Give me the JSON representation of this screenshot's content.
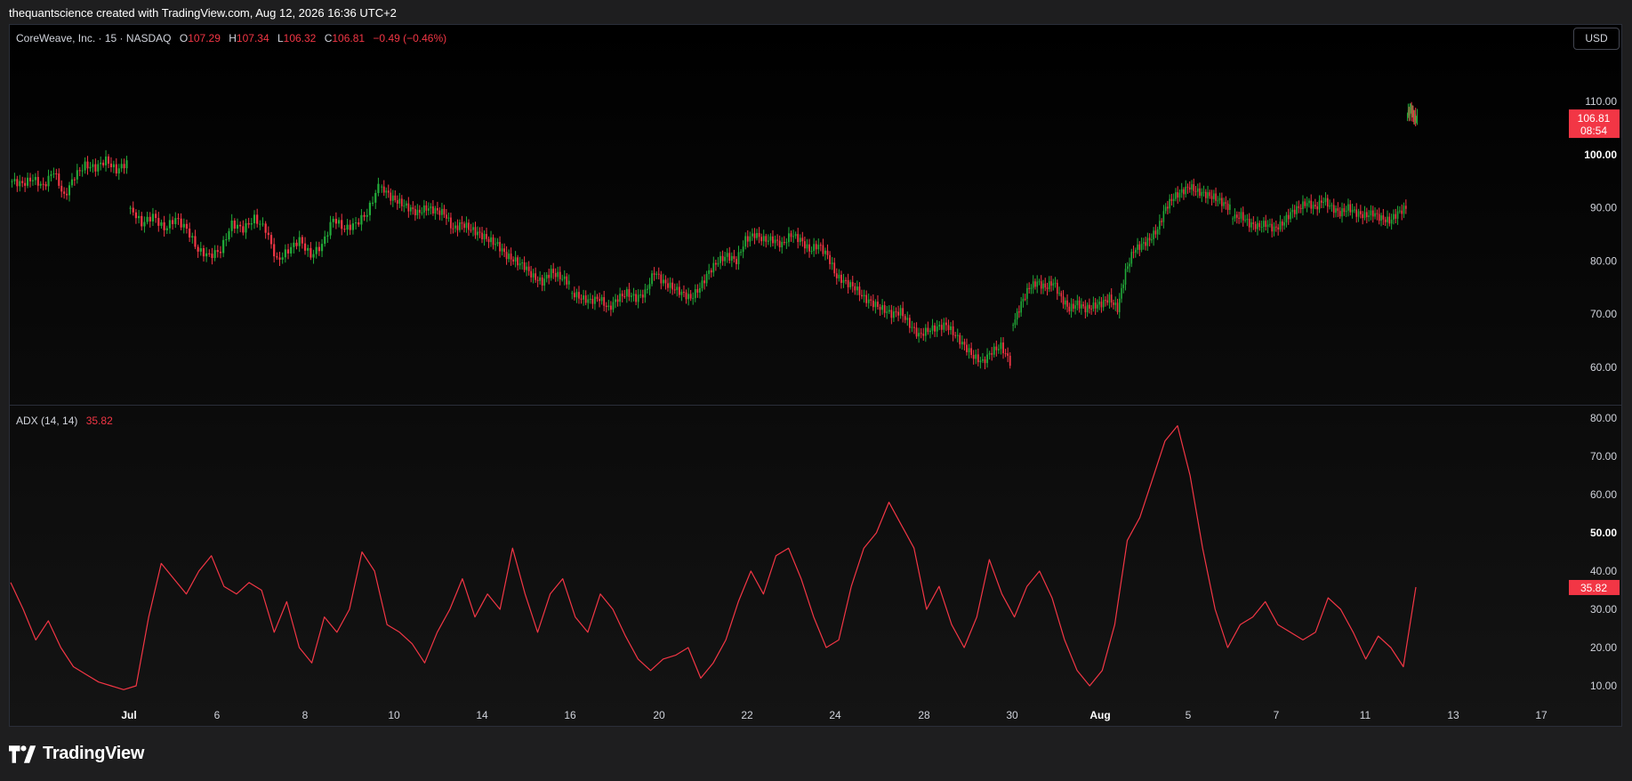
{
  "header": {
    "credit": "thequantscience created with TradingView.com, Aug 12, 2026 16:36 UTC+2"
  },
  "legend": {
    "symbol": "CoreWeave, Inc. · 15 · NASDAQ",
    "o_label": "O",
    "o": "107.29",
    "h_label": "H",
    "h": "107.34",
    "l_label": "L",
    "l": "106.32",
    "c_label": "C",
    "c": "106.81",
    "change": "−0.49 (−0.46%)"
  },
  "indicator_legend": {
    "name": "ADX (14, 14)",
    "value": "35.82"
  },
  "currency_button": "USD",
  "brand": {
    "name": "TradingView"
  },
  "colors": {
    "up": "#22ab3a",
    "down": "#f23645",
    "adx": "#f23645",
    "background": "#000000",
    "page": "#1e1e1f"
  },
  "chart_data": [
    {
      "type": "candlestick",
      "title": "CoreWeave, Inc. · 15 · NASDAQ",
      "ylim": [
        55,
        120
      ],
      "y_ticks": [
        60,
        70,
        80,
        90,
        100,
        110
      ],
      "y_tick_labels": [
        "60.00",
        "70.00",
        "80.00",
        "90.00",
        "100.00",
        "110.00"
      ],
      "x_ticks": [
        "Jul",
        "6",
        "8",
        "10",
        "14",
        "16",
        "20",
        "22",
        "24",
        "28",
        "30",
        "Aug",
        "5",
        "7",
        "11",
        "13",
        "17"
      ],
      "price_label": "106.81",
      "countdown": "08:54",
      "series": [
        {
          "session": 1,
          "prices": [
            95,
            94.5,
            95.5,
            94,
            97,
            92,
            96,
            98,
            97.5,
            99,
            97,
            98.5
          ]
        },
        {
          "session": 2,
          "prices": [
            90,
            87,
            88.5,
            86,
            88,
            86,
            82,
            81,
            82,
            87,
            86,
            88,
            86,
            80,
            82,
            84,
            81,
            83,
            88,
            86,
            87,
            89,
            94
          ]
        },
        {
          "session": 3,
          "prices": [
            94,
            92,
            91,
            90,
            89,
            90,
            89.5,
            89,
            86,
            87,
            86,
            85,
            84,
            83,
            81,
            80,
            79,
            77,
            76,
            78,
            77,
            76
          ]
        },
        {
          "session": 4,
          "prices": [
            74,
            73,
            72.5,
            73,
            71,
            73,
            74,
            73,
            74,
            78,
            76,
            75,
            74,
            73,
            75,
            78,
            80,
            81,
            80,
            84,
            85,
            84,
            84,
            83,
            85,
            84,
            82,
            83,
            81,
            77,
            76,
            75,
            73,
            72,
            71,
            70,
            70.5,
            68,
            66,
            67,
            67.5,
            68,
            66,
            64,
            62,
            61,
            63,
            64,
            61
          ]
        },
        {
          "session": 5,
          "prices": [
            68,
            72,
            75,
            76,
            75,
            76,
            73,
            71,
            72,
            71,
            71.5,
            72,
            73,
            71,
            78,
            82,
            83,
            84,
            86,
            90,
            92,
            93,
            94,
            93,
            92.5,
            92,
            91,
            90
          ]
        },
        {
          "session": 6,
          "prices": [
            88,
            88.5,
            87,
            86.5,
            87,
            86,
            87,
            89,
            90,
            91,
            90,
            91.5,
            90,
            89,
            90,
            89,
            88.5,
            89,
            88,
            87.5,
            89,
            90
          ]
        },
        {
          "session": 7,
          "prices": [
            107.5,
            108.5,
            107,
            106.81
          ]
        }
      ],
      "last_price": 106.81
    },
    {
      "type": "line",
      "title": "ADX (14, 14)",
      "ylim": [
        5,
        82
      ],
      "y_ticks": [
        10,
        20,
        30,
        40,
        50,
        60,
        70,
        80
      ],
      "y_tick_labels": [
        "10.00",
        "20.00",
        "30.00",
        "40.00",
        "50.00",
        "60.00",
        "70.00",
        "80.00"
      ],
      "value_label": "35.82",
      "series": [
        {
          "values": [
            37,
            30,
            22,
            27,
            20,
            15,
            13,
            11,
            10,
            9,
            10,
            28,
            42,
            38,
            34,
            40,
            44,
            36,
            34,
            37,
            35,
            24,
            32,
            20,
            16,
            28,
            24,
            30,
            45,
            40,
            26,
            24,
            21,
            16,
            24,
            30,
            38,
            28,
            34,
            30,
            46,
            34,
            24,
            34,
            38,
            28,
            24,
            34,
            30,
            23,
            17,
            14,
            17,
            18,
            20,
            12,
            16,
            22,
            32,
            40,
            34,
            44,
            46,
            38,
            28,
            20,
            22,
            36,
            46,
            50,
            58,
            52,
            46,
            30,
            36,
            26,
            20,
            28,
            43,
            34,
            28,
            36,
            40,
            33,
            22,
            14,
            10,
            14,
            26,
            48,
            54,
            64,
            74,
            78,
            65,
            46,
            30,
            20,
            26,
            28,
            32,
            26,
            24,
            22,
            24,
            33,
            30,
            24,
            17,
            23,
            20,
            15,
            35.82
          ]
        }
      ],
      "last_value": 35.82
    }
  ]
}
